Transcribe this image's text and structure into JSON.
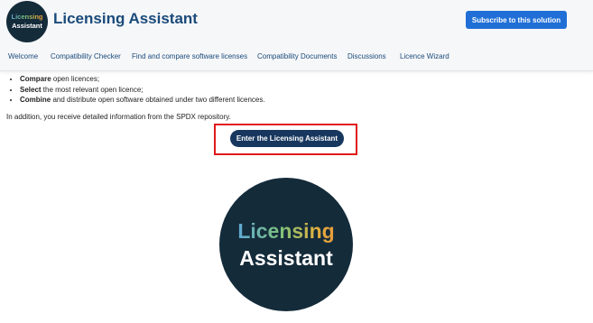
{
  "header": {
    "logo": {
      "line1": "Licensing",
      "line2": "Assistant"
    },
    "title": "Licensing Assistant",
    "subscribe_label": "Subscribe to this solution"
  },
  "nav": {
    "items": [
      {
        "label": "Welcome"
      },
      {
        "label": "Compatibility Checker"
      },
      {
        "label": "Find and compare software licenses"
      },
      {
        "label": "Compatibility Documents"
      },
      {
        "label": "Discussions"
      },
      {
        "label": "Licence Wizard"
      }
    ]
  },
  "main": {
    "features": [
      {
        "bold": "Compare",
        "rest": " open licences;"
      },
      {
        "bold": "Select",
        "rest": " the most relevant open licence;"
      },
      {
        "bold": "Combine",
        "rest": " and distribute open software obtained under two different licences."
      }
    ],
    "info_text": "In addition, you receive detailed information from the SPDX repository.",
    "enter_button_label": "Enter the Licensing Assistant",
    "big_logo": {
      "line1": "Licensing",
      "line2": "Assistant"
    }
  },
  "colors": {
    "brand_dark": "#142b3a",
    "title_blue": "#1a4a7a",
    "subscribe_blue": "#1f6fd6",
    "enter_button_navy": "#17375e",
    "highlight_red": "#e01a1a"
  }
}
